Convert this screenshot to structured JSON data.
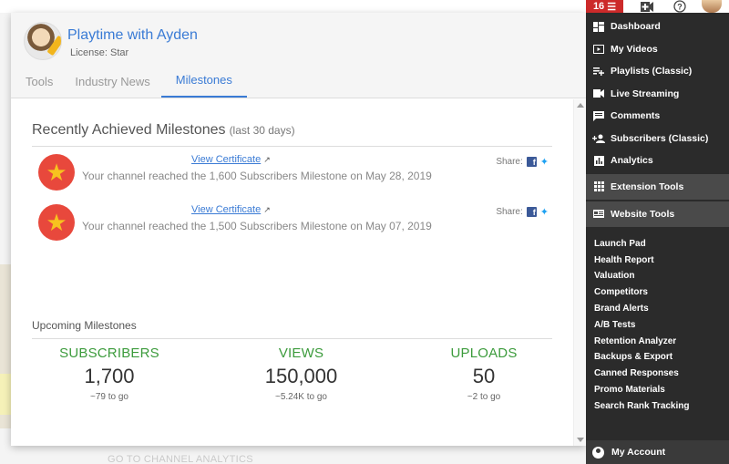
{
  "topbar": {
    "vidiq_label": "16",
    "menu_icon": "hamburger-icon",
    "add_video_icon": "add-video-icon",
    "help_icon": "help-icon"
  },
  "background": {
    "link_text": "GO TO CHANNEL ANALYTICS"
  },
  "channel": {
    "name": "Playtime with Ayden",
    "license": "License: Star"
  },
  "tabs": [
    {
      "label": "Tools"
    },
    {
      "label": "Industry News"
    },
    {
      "label": "Milestones"
    }
  ],
  "recent": {
    "title": "Recently Achieved Milestones",
    "subtitle": "(last 30 days)",
    "items": [
      {
        "link": "View Certificate",
        "text": "Your channel reached the 1,600 Subscribers Milestone on May 28, 2019",
        "share": "Share:"
      },
      {
        "link": "View Certificate",
        "text": "Your channel reached the 1,500 Subscribers Milestone on May 07, 2019",
        "share": "Share:"
      }
    ]
  },
  "upcoming": {
    "title": "Upcoming Milestones",
    "columns": [
      {
        "label": "SUBSCRIBERS",
        "value": "1,700",
        "togo": "~79 to go"
      },
      {
        "label": "VIEWS",
        "value": "150,000",
        "togo": "~5.24K to go"
      },
      {
        "label": "UPLOADS",
        "value": "50",
        "togo": "~2 to go"
      }
    ],
    "accent_color": "#3c9b3c"
  },
  "sidebar": {
    "items": [
      {
        "label": "Dashboard",
        "icon": "dashboard-icon"
      },
      {
        "label": "My Videos",
        "icon": "video-icon"
      },
      {
        "label": "Playlists (Classic)",
        "icon": "playlist-add-icon"
      },
      {
        "label": "Live Streaming",
        "icon": "camera-icon"
      },
      {
        "label": "Comments",
        "icon": "comment-icon"
      },
      {
        "label": "Subscribers (Classic)",
        "icon": "add-person-icon"
      },
      {
        "label": "Analytics",
        "icon": "analytics-icon"
      }
    ],
    "extension_tools": "Extension Tools",
    "website_tools": "Website Tools",
    "sub_items": [
      "Launch Pad",
      "Health Report",
      "Valuation",
      "Competitors",
      "Brand Alerts",
      "A/B Tests",
      "Retention Analyzer",
      "Backups & Export",
      "Canned Responses",
      "Promo Materials",
      "Search Rank Tracking"
    ],
    "account": "My Account"
  }
}
